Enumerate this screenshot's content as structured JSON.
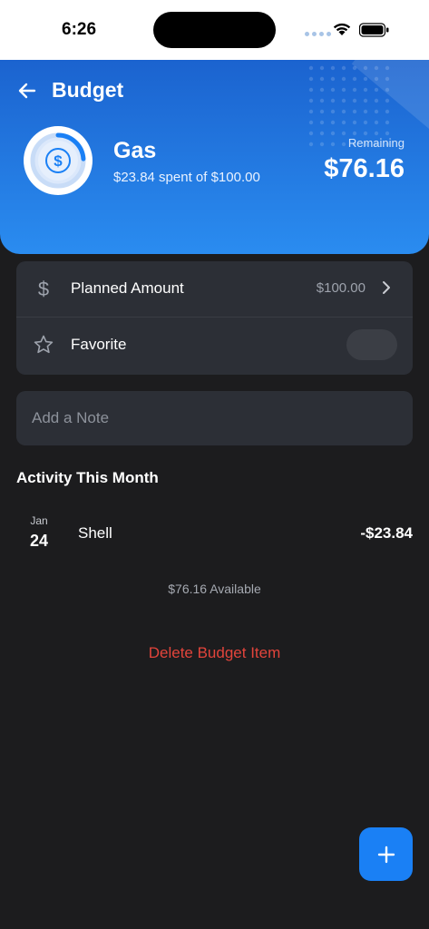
{
  "status_bar": {
    "time": "6:26"
  },
  "header": {
    "back_label": "Budget",
    "category": "Gas",
    "spent_summary": "$23.84 spent of $100.00",
    "remaining_label": "Remaining",
    "remaining_value": "$76.16",
    "progress_fraction": 0.2384,
    "colors": {
      "gradient_top": "#1b63cf",
      "gradient_bottom": "#2a8cf0"
    }
  },
  "settings": {
    "planned_label": "Planned Amount",
    "planned_value": "$100.00",
    "favorite_label": "Favorite",
    "favorite_on": false
  },
  "note": {
    "placeholder": "Add a Note",
    "value": ""
  },
  "activity": {
    "title": "Activity This Month",
    "transactions": [
      {
        "month": "Jan",
        "day": "24",
        "merchant": "Shell",
        "amount": "-$23.84"
      }
    ],
    "available": "$76.16 Available"
  },
  "delete_label": "Delete Budget Item",
  "colors": {
    "accent": "#1a80f5",
    "danger": "#e2443b",
    "background": "#1c1c1e",
    "card": "#2c2f36"
  },
  "icons": {
    "back": "arrow-left-icon",
    "ring_center": "dollar-icon",
    "planned": "dollar-icon",
    "favorite": "star-outline-icon",
    "chevron": "chevron-right-icon",
    "add": "plus-icon"
  }
}
